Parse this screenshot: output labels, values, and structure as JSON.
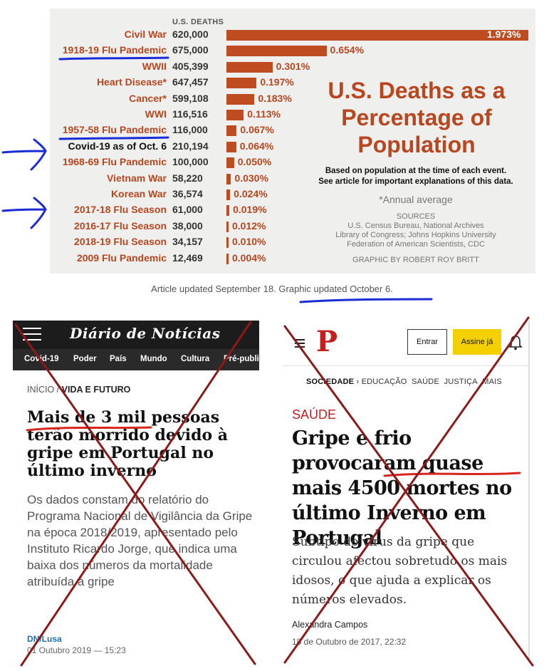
{
  "infographic": {
    "deaths_header": "U.S. DEATHS",
    "title_lines": [
      "U.S. Deaths as a",
      "Percentage of",
      "Population"
    ],
    "note_lines": [
      "Based on population at the time of each event.",
      "See article for important explanations of this data."
    ],
    "annual_note": "*Annual average",
    "sources_header": "SOURCES",
    "sources_lines": [
      "U.S. Census Bureau, National Archives",
      "Library of Congress; Johns Hopkins University",
      "Federation of American Scientists, CDC"
    ],
    "credit": "GRAPHIC BY ROBERT ROY BRITT",
    "colors": {
      "bar": "#bf4b20",
      "label": "#b8461e",
      "highlight": "#111111",
      "annotation": "#1a2bd8"
    }
  },
  "chart_data": {
    "type": "bar",
    "orientation": "horizontal",
    "categories": [
      "Civil War",
      "1918-19 Flu Pandemic",
      "WWII",
      "Heart Disease*",
      "Cancer*",
      "WWI",
      "1957-58 Flu Pandemic",
      "Covid-19 as of Oct. 6",
      "1968-69 Flu Pandemic",
      "Vietnam War",
      "Korean War",
      "2017-18 Flu Season",
      "2016-17 Flu Season",
      "2018-19 Flu Season",
      "2009 Flu Pandemic"
    ],
    "deaths": [
      "620,000",
      "675,000",
      "405,399",
      "647,457",
      "599,108",
      "116,516",
      "116,000",
      "210,194",
      "100,000",
      "58,220",
      "36,574",
      "61,000",
      "38,000",
      "34,157",
      "12,469"
    ],
    "percent_labels": [
      "1.973%",
      "0.654%",
      "0.301%",
      "0.197%",
      "0.183%",
      "0.113%",
      "0.067%",
      "0.064%",
      "0.050%",
      "0.030%",
      "0.024%",
      "0.019%",
      "0.012%",
      "0.010%",
      "0.004%"
    ],
    "values": [
      1.973,
      0.654,
      0.301,
      0.197,
      0.183,
      0.113,
      0.067,
      0.064,
      0.05,
      0.03,
      0.024,
      0.019,
      0.012,
      0.01,
      0.004
    ],
    "xlim": [
      0,
      1.973
    ],
    "highlight_category": "Covid-19 as of Oct. 6",
    "title": "U.S. Deaths as a Percentage of Population"
  },
  "article_updated": "Article updated September 18. Graphic updated October 6.",
  "dn": {
    "logo": "Diário de Notícias",
    "nav": [
      "Covid-19",
      "Poder",
      "País",
      "Mundo",
      "Cultura",
      "Pré-publi"
    ],
    "breadcrumb_home": "INÍCIO /",
    "breadcrumb_section": "VIDA E FUTURO",
    "headline": "Mais de 3 mil pessoas terão morrido devido à gripe em Portugal no último inverno",
    "summary": "Os dados constam do relatório do Programa Nacional de Vigilância da Gripe na época 2018/2019, apresentado pelo Instituto Ricardo Jorge, que indica uma baixa dos números da mortalidade atribuída à gripe",
    "author": "DN/Lusa",
    "date": "01 Outubro 2019 — 15:23"
  },
  "publico": {
    "logo": "P",
    "login": "Entrar",
    "subscribe": "Assine já",
    "sections": [
      "SOCIEDADE",
      "EDUCAÇÃO",
      "SAÚDE",
      "JUSTIÇA",
      "MAIS"
    ],
    "section_separator": "›",
    "section_label": "SAÚDE",
    "headline": "Gripe e frio provocaram quase mais 4500 mortes no último Inverno em Portugal",
    "summary": "Subtipo do vírus da gripe que circulou afectou sobretudo os mais idosos, o que ajuda a explicar os números elevados.",
    "author": "Alexandra Campos",
    "date": "18 de Outubro de 2017, 22:32"
  }
}
